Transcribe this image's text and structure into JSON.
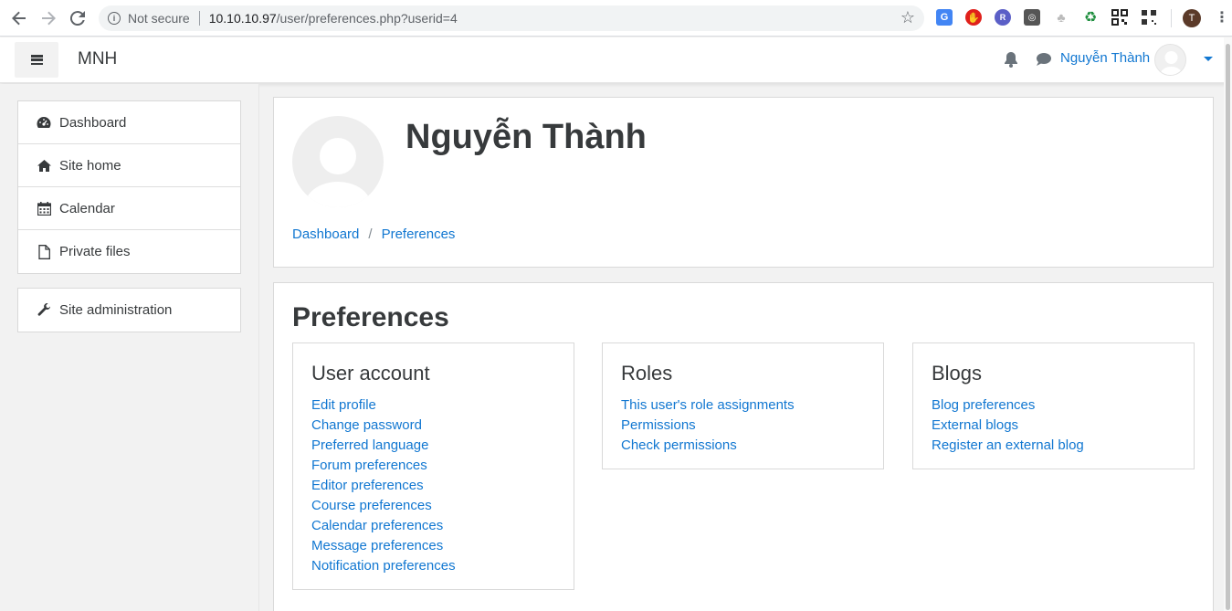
{
  "browser": {
    "security_label": "Not secure",
    "url_host": "10.10.10.97",
    "url_path": "/user/preferences.php?userid=4",
    "profile_initial": "T"
  },
  "navbar": {
    "site_name": "MNH",
    "user_name": "Nguyễn Thành"
  },
  "sidebar": {
    "items": [
      {
        "label": "Dashboard",
        "icon": "dashboard-icon"
      },
      {
        "label": "Site home",
        "icon": "home-icon"
      },
      {
        "label": "Calendar",
        "icon": "calendar-icon"
      },
      {
        "label": "Private files",
        "icon": "file-icon"
      }
    ],
    "admin_item": {
      "label": "Site administration",
      "icon": "wrench-icon"
    }
  },
  "header": {
    "fullname": "Nguyễn Thành",
    "breadcrumb": [
      "Dashboard",
      "Preferences"
    ]
  },
  "main": {
    "title": "Preferences",
    "sections": [
      {
        "title": "User account",
        "links": [
          "Edit profile",
          "Change password",
          "Preferred language",
          "Forum preferences",
          "Editor preferences",
          "Course preferences",
          "Calendar preferences",
          "Message preferences",
          "Notification preferences"
        ]
      },
      {
        "title": "Roles",
        "links": [
          "This user's role assignments",
          "Permissions",
          "Check permissions"
        ]
      },
      {
        "title": "Blogs",
        "links": [
          "Blog preferences",
          "External blogs",
          "Register an external blog"
        ]
      }
    ]
  },
  "colors": {
    "link": "#1177d1",
    "text": "#373a3c",
    "background": "#f2f2f2"
  }
}
